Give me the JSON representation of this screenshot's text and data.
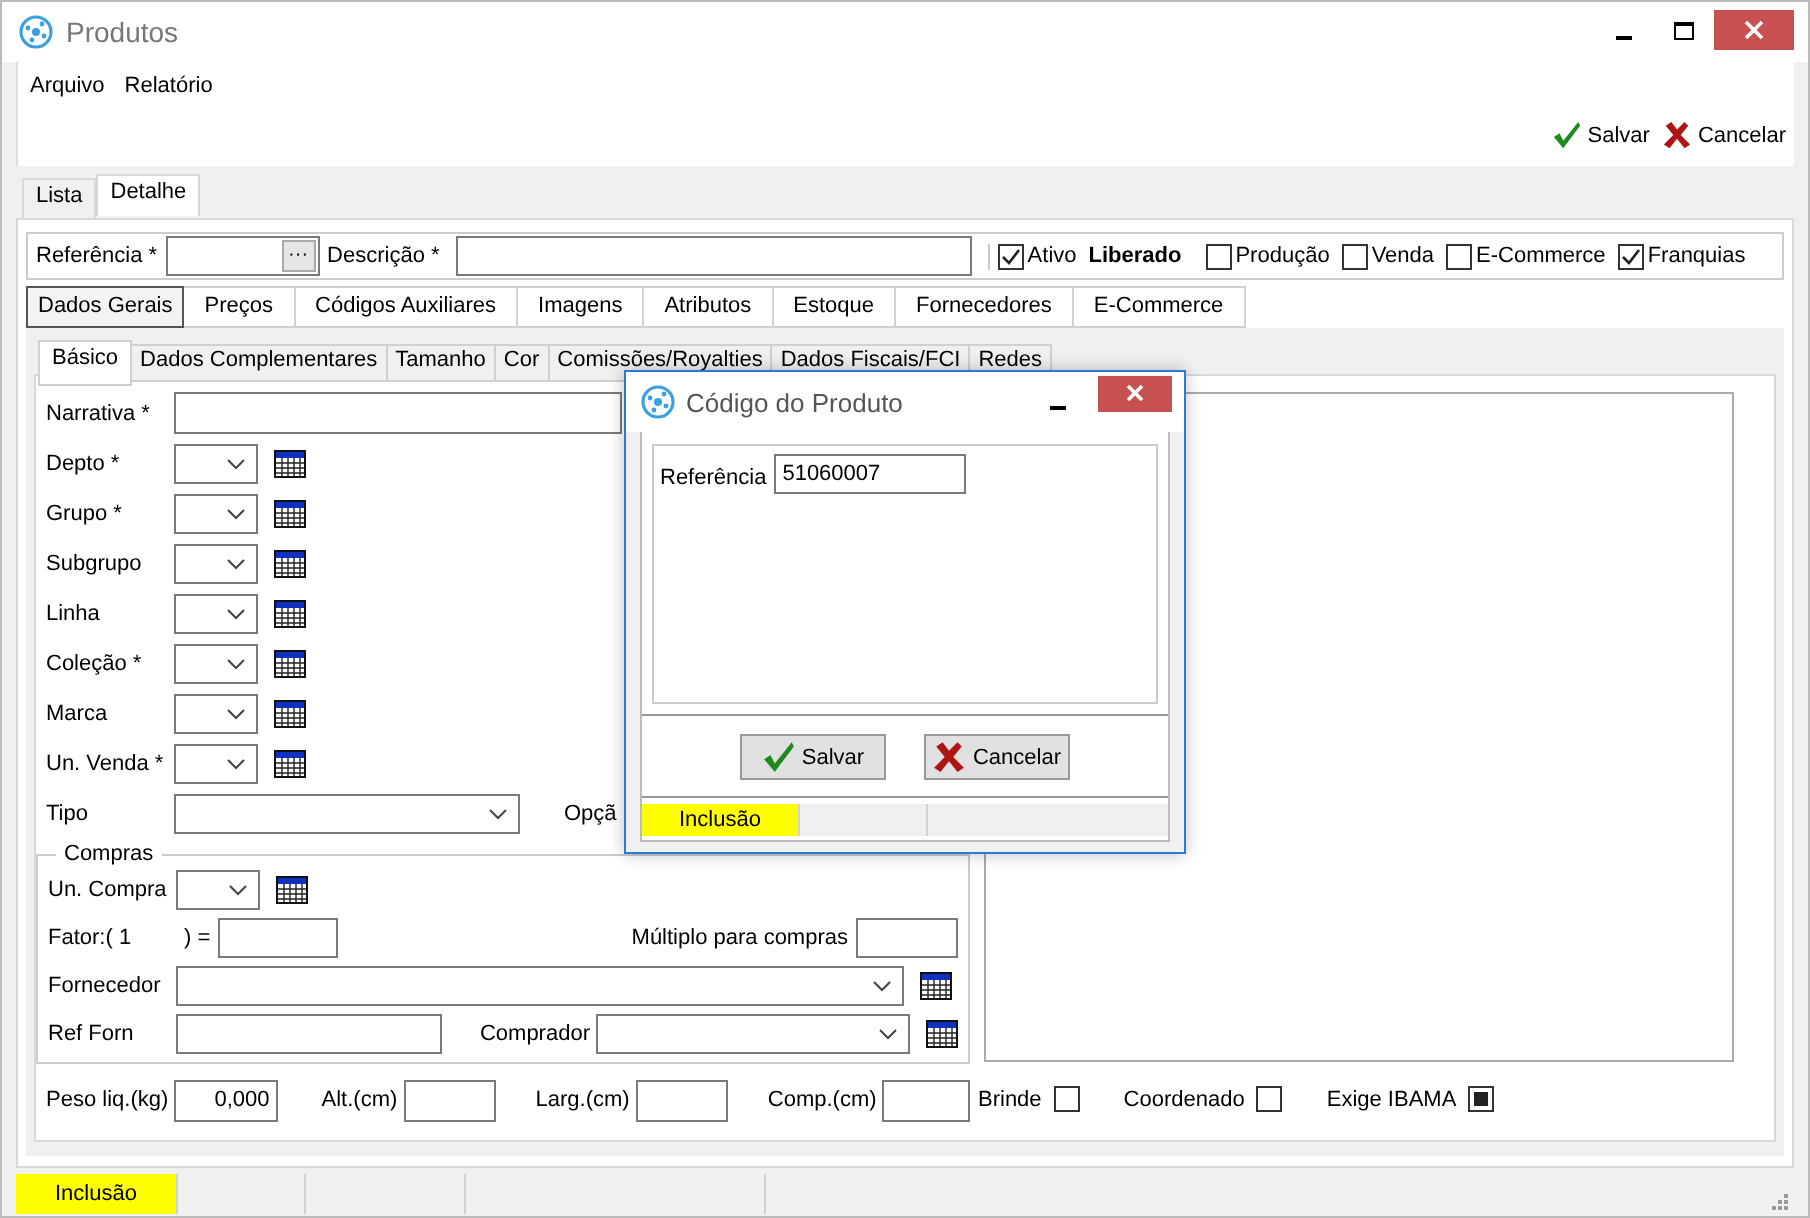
{
  "window": {
    "title": "Produtos"
  },
  "menu": [
    "Arquivo",
    "Relatório"
  ],
  "toolbar": [
    {
      "label": "Salvar",
      "kind": "save"
    },
    {
      "label": "Cancelar",
      "kind": "cancel"
    }
  ],
  "tabs": [
    {
      "label": "Lista",
      "selected": false
    },
    {
      "label": "Detalhe",
      "selected": true
    }
  ],
  "header": {
    "referencia": "Referência *",
    "lookup": "···",
    "descricao": "Descrição *",
    "flags": [
      {
        "label": "Ativo",
        "kind": "check",
        "checked": true
      },
      {
        "label": "Liberado",
        "kind": "label"
      },
      {
        "label": "Produção",
        "kind": "check",
        "checked": false
      },
      {
        "label": "Venda",
        "kind": "check",
        "checked": false
      },
      {
        "label": "E-Commerce",
        "kind": "check",
        "checked": false
      },
      {
        "label": "Franquias",
        "kind": "check",
        "checked": true
      }
    ]
  },
  "section_tabs": [
    {
      "label": "Dados Gerais",
      "selected": true
    },
    {
      "label": "Preços",
      "selected": false
    },
    {
      "label": "Códigos Auxiliares",
      "selected": false
    },
    {
      "label": "Imagens",
      "selected": false
    },
    {
      "label": "Atributos",
      "selected": false
    },
    {
      "label": "Estoque",
      "selected": false
    },
    {
      "label": "Fornecedores",
      "selected": false
    },
    {
      "label": "E-Commerce",
      "selected": false
    }
  ],
  "sub_tabs": [
    {
      "label": "Básico",
      "selected": true
    },
    {
      "label": "Dados Complementares",
      "selected": false
    },
    {
      "label": "Tamanho",
      "selected": false
    },
    {
      "label": "Cor",
      "selected": false
    },
    {
      "label": "Comissões/Royalties",
      "selected": false
    },
    {
      "label": "Dados Fiscais/FCI",
      "selected": false
    },
    {
      "label": "Redes",
      "selected": false
    }
  ],
  "form": {
    "narrativa": "Narrativa *",
    "combo_rows": [
      "Depto *",
      "Grupo *",
      "Subgrupo",
      "Linha",
      "Coleção *",
      "Marca",
      "Un. Venda *"
    ],
    "tipo": "Tipo",
    "opcao": "Opçã",
    "compras": {
      "title": "Compras",
      "un_compra": "Un. Compra",
      "fator": "Fator:( 1",
      "fator_close": ") =",
      "multiplo": "Múltiplo para compras",
      "fornecedor": "Fornecedor",
      "ref_forn": "Ref Forn",
      "comprador": "Comprador"
    },
    "measures": [
      {
        "label": "Peso liq.(kg)",
        "value": "0,000"
      },
      {
        "label": "Alt.(cm)"
      },
      {
        "label": "Larg.(cm)"
      },
      {
        "label": "Comp.(cm)"
      }
    ],
    "flags": [
      {
        "label": "Brinde",
        "checked": false
      },
      {
        "label": "Coordenado",
        "checked": false
      },
      {
        "label": "Exige IBAMA",
        "checked": true
      }
    ]
  },
  "status_bar": {
    "mode": "Inclusão"
  },
  "dialog": {
    "title": "Código do Produto",
    "field": {
      "label": "Referência",
      "value": "51060007"
    },
    "buttons": [
      {
        "label": "Salvar",
        "kind": "save"
      },
      {
        "label": "Cancelar",
        "kind": "cancel"
      }
    ],
    "status": "Inclusão"
  }
}
